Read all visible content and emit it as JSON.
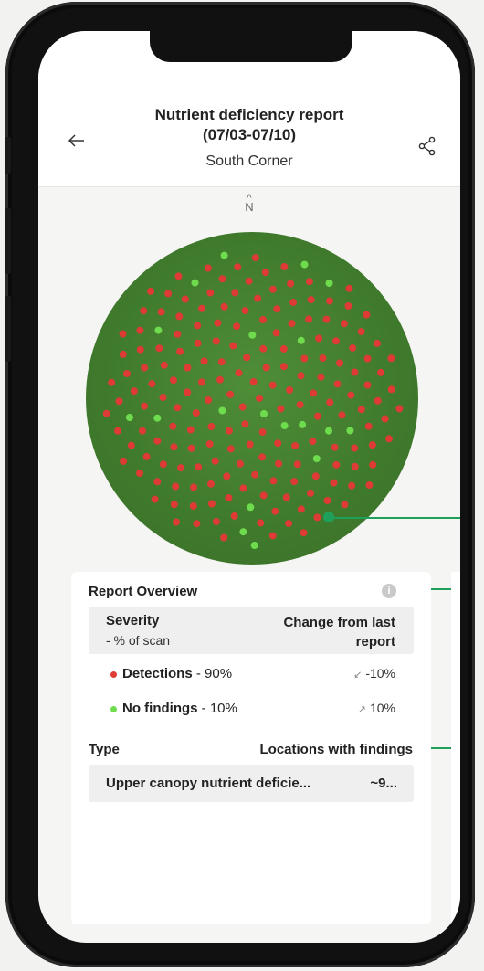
{
  "header": {
    "title_line1": "Nutrient deficiency report",
    "title_line2": "(07/03-07/10)",
    "subtitle": "South Corner",
    "back_icon": "arrow-left-icon",
    "share_icon": "share-icon"
  },
  "map": {
    "north_arrow": "^",
    "north_label": "N",
    "colors": {
      "detection": "#dd3b33",
      "no_finding": "#6fdc4e",
      "canopy": "#417a2e"
    }
  },
  "overview": {
    "title": "Report Overview",
    "info_icon": "info-icon",
    "severity_label": "Severity",
    "severity_sub": "- % of scan",
    "change_label": "Change from last report",
    "rows": [
      {
        "name": "Detections",
        "pct": " - 90%",
        "color": "#dd3b33",
        "arrow": "↙",
        "change": "-10%"
      },
      {
        "name": "No findings",
        "pct": " - 10%",
        "color": "#6fdc4e",
        "arrow": "↗",
        "change": "10%"
      }
    ],
    "type_label": "Type",
    "locations_label": "Locations with findings",
    "types": [
      {
        "name": "Upper canopy nutrient deficie...",
        "count": "~9..."
      }
    ]
  },
  "accent": "#1fa05a"
}
